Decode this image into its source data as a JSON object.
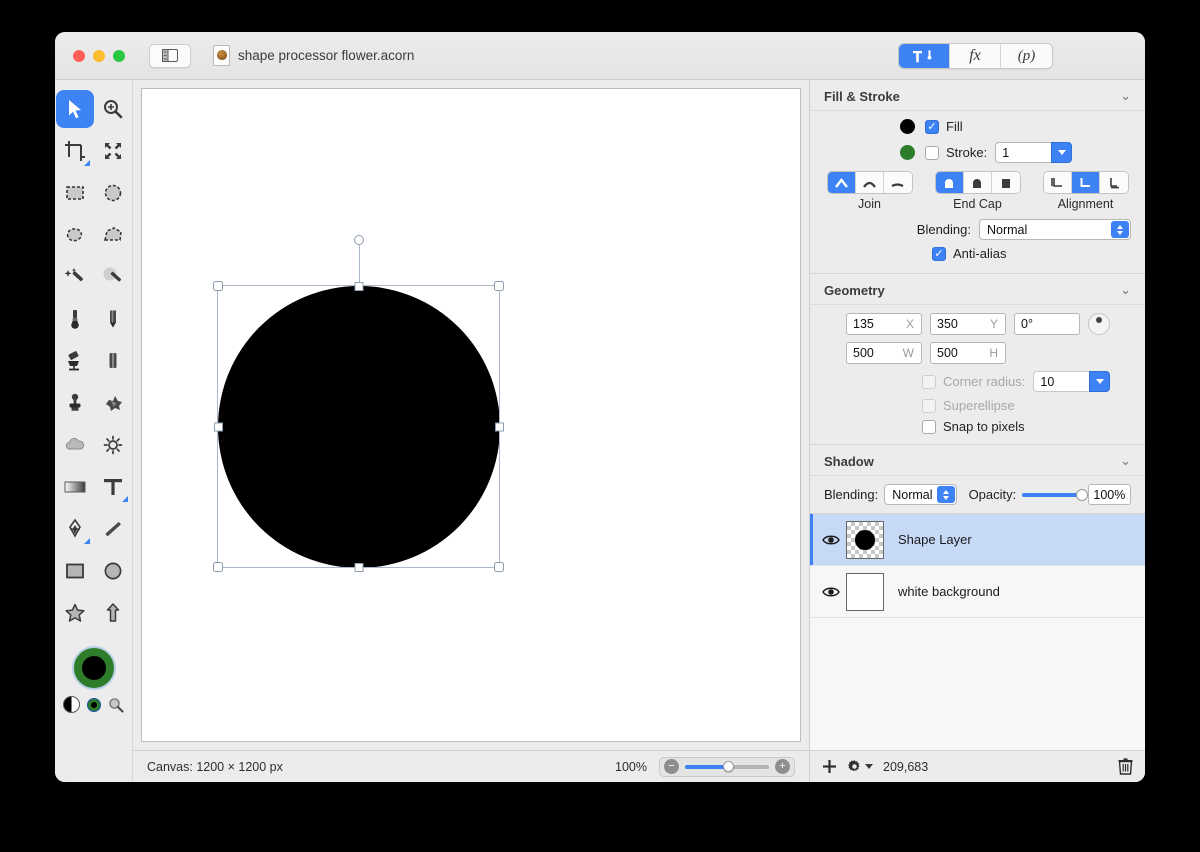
{
  "window": {
    "traffic_lights": [
      "close",
      "minimize",
      "zoom"
    ],
    "sidebar_toggle_icon": "sidebar-toggle-icon",
    "document_title": "shape processor flower.acorn",
    "inspector_tabs": [
      {
        "id": "tools",
        "label": "",
        "icon": "hammer-brush-icon",
        "active": true
      },
      {
        "id": "effects",
        "label": "fx",
        "icon": "fx-icon",
        "active": false
      },
      {
        "id": "presets",
        "label": "(p)",
        "icon": "palette-icon",
        "active": false
      }
    ]
  },
  "tools": {
    "items": [
      {
        "name": "move-tool",
        "icon": "arrow-cursor-icon",
        "active": true,
        "submenu": false
      },
      {
        "name": "zoom-tool",
        "icon": "magnifier-plus-icon",
        "active": false,
        "submenu": false
      },
      {
        "name": "crop-tool",
        "icon": "crop-icon",
        "active": false,
        "submenu": true
      },
      {
        "name": "transform-tool",
        "icon": "move-arrows-icon",
        "active": false,
        "submenu": false
      },
      {
        "name": "rectangular-select-tool",
        "icon": "marquee-rect-icon",
        "active": false,
        "submenu": false
      },
      {
        "name": "elliptical-select-tool",
        "icon": "marquee-ellipse-icon",
        "active": false,
        "submenu": false
      },
      {
        "name": "lasso-tool",
        "icon": "lasso-icon",
        "active": false,
        "submenu": false
      },
      {
        "name": "polygon-lasso-tool",
        "icon": "polygon-lasso-icon",
        "active": false,
        "submenu": false
      },
      {
        "name": "magic-wand-tool",
        "icon": "magic-wand-icon",
        "active": false,
        "submenu": false
      },
      {
        "name": "instant-alpha-tool",
        "icon": "magic-wand-soft-icon",
        "active": false,
        "submenu": false
      },
      {
        "name": "brush-tool",
        "icon": "paintbrush-icon",
        "active": false,
        "submenu": false
      },
      {
        "name": "pencil-tool",
        "icon": "pencil-icon",
        "active": false,
        "submenu": false
      },
      {
        "name": "paint-bucket-tool",
        "icon": "paint-bucket-icon",
        "active": false,
        "submenu": false
      },
      {
        "name": "eraser-tool",
        "icon": "eraser-icon",
        "active": false,
        "submenu": false
      },
      {
        "name": "clone-stamp-tool",
        "icon": "clone-stamp-icon",
        "active": false,
        "submenu": false
      },
      {
        "name": "smudge-tool",
        "icon": "smudge-icon",
        "active": false,
        "submenu": false
      },
      {
        "name": "blur-tool",
        "icon": "cloud-blur-icon",
        "active": false,
        "submenu": false
      },
      {
        "name": "dodge-burn-tool",
        "icon": "sun-dodge-icon",
        "active": false,
        "submenu": false
      },
      {
        "name": "gradient-tool",
        "icon": "gradient-icon",
        "active": false,
        "submenu": false
      },
      {
        "name": "text-tool",
        "icon": "text-t-icon",
        "active": false,
        "submenu": true
      },
      {
        "name": "pen-tool",
        "icon": "pen-nib-icon",
        "active": false,
        "submenu": true
      },
      {
        "name": "line-tool",
        "icon": "line-icon",
        "active": false,
        "submenu": false
      },
      {
        "name": "rectangle-tool",
        "icon": "rectangle-icon",
        "active": false,
        "submenu": false
      },
      {
        "name": "ellipse-tool",
        "icon": "ellipse-icon",
        "active": false,
        "submenu": false
      },
      {
        "name": "star-tool",
        "icon": "star-icon",
        "active": false,
        "submenu": false
      },
      {
        "name": "arrow-tool",
        "icon": "arrow-up-icon",
        "active": false,
        "submenu": false
      }
    ],
    "colors": {
      "fill": "#000000",
      "stroke": "#2d7d2a",
      "bw_reset_icon": "black-white-reset-icon",
      "small_swatch_icon": "swap-colors-icon",
      "magnifier_icon": "magnifier-icon"
    }
  },
  "inspector": {
    "fill_stroke": {
      "title": "Fill & Stroke",
      "fill": {
        "label": "Fill",
        "checked": true,
        "color": "#000000"
      },
      "stroke": {
        "label": "Stroke:",
        "checked": false,
        "color": "#2d7d2a",
        "width": "1"
      },
      "join": {
        "label": "Join",
        "options": [
          "miter-join-icon",
          "round-join-icon",
          "bevel-join-icon"
        ],
        "selected": 0
      },
      "end_cap": {
        "label": "End Cap",
        "options": [
          "butt-cap-icon",
          "round-cap-icon",
          "square-cap-icon"
        ],
        "selected": 0
      },
      "alignment": {
        "label": "Alignment",
        "options": [
          "align-inside-icon",
          "align-center-icon",
          "align-outside-icon"
        ],
        "selected": 1
      },
      "blending": {
        "label": "Blending:",
        "value": "Normal"
      },
      "anti_alias": {
        "label": "Anti-alias",
        "checked": true
      }
    },
    "geometry": {
      "title": "Geometry",
      "x": {
        "value": "135",
        "unit": "X"
      },
      "y": {
        "value": "350",
        "unit": "Y"
      },
      "rotation": {
        "value": "0°"
      },
      "w": {
        "value": "500",
        "unit": "W"
      },
      "h": {
        "value": "500",
        "unit": "H"
      },
      "corner_radius": {
        "label": "Corner radius:",
        "checked": false,
        "disabled": true,
        "value": "10"
      },
      "superellipse": {
        "label": "Superellipse",
        "checked": false,
        "disabled": true
      },
      "snap_to_pixels": {
        "label": "Snap to pixels",
        "checked": false,
        "disabled": false
      }
    },
    "shadow": {
      "title": "Shadow",
      "blending": {
        "label": "Blending:",
        "value": "Normal"
      },
      "opacity": {
        "label": "Opacity:",
        "value": "100%",
        "percent": 100
      }
    }
  },
  "layers": {
    "items": [
      {
        "name": "Shape Layer",
        "selected": true,
        "visible": true,
        "thumb": "checkerboard-circle"
      },
      {
        "name": "white background",
        "selected": false,
        "visible": true,
        "thumb": "white"
      }
    ],
    "toolbar": {
      "add_icon": "plus-icon",
      "gear_icon": "gear-icon",
      "count": "209,683",
      "delete_icon": "trash-icon"
    }
  },
  "status_bar": {
    "canvas_info": "Canvas: 1200 × 1200 px",
    "zoom_level": "100%",
    "zoom_out_icon": "minus-icon",
    "zoom_in_icon": "plus-icon",
    "zoom_slider_percent": 52
  },
  "canvas": {
    "shape": {
      "type": "ellipse",
      "fill": "#000000"
    },
    "selection_visible": true
  }
}
